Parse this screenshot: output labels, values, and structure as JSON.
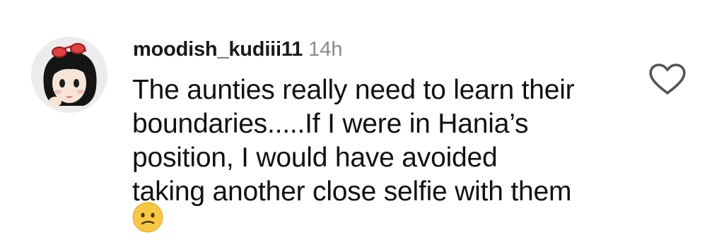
{
  "comment": {
    "username": "moodish_kudiii11",
    "timestamp": "14h",
    "text_lines": [
      "The aunties really need to learn their",
      "boundaries.....If I were in Hania’s",
      "position, I would have avoided",
      "taking another close selfie with them"
    ],
    "emoji": "confused-face",
    "like_icon": "heart-outline-icon",
    "avatar_icon": "cartoon-girl-avatar"
  },
  "colors": {
    "text": "#111111",
    "timestamp": "#8a8a8a",
    "icon": "#555555",
    "emoji_face": "#f7c843"
  }
}
